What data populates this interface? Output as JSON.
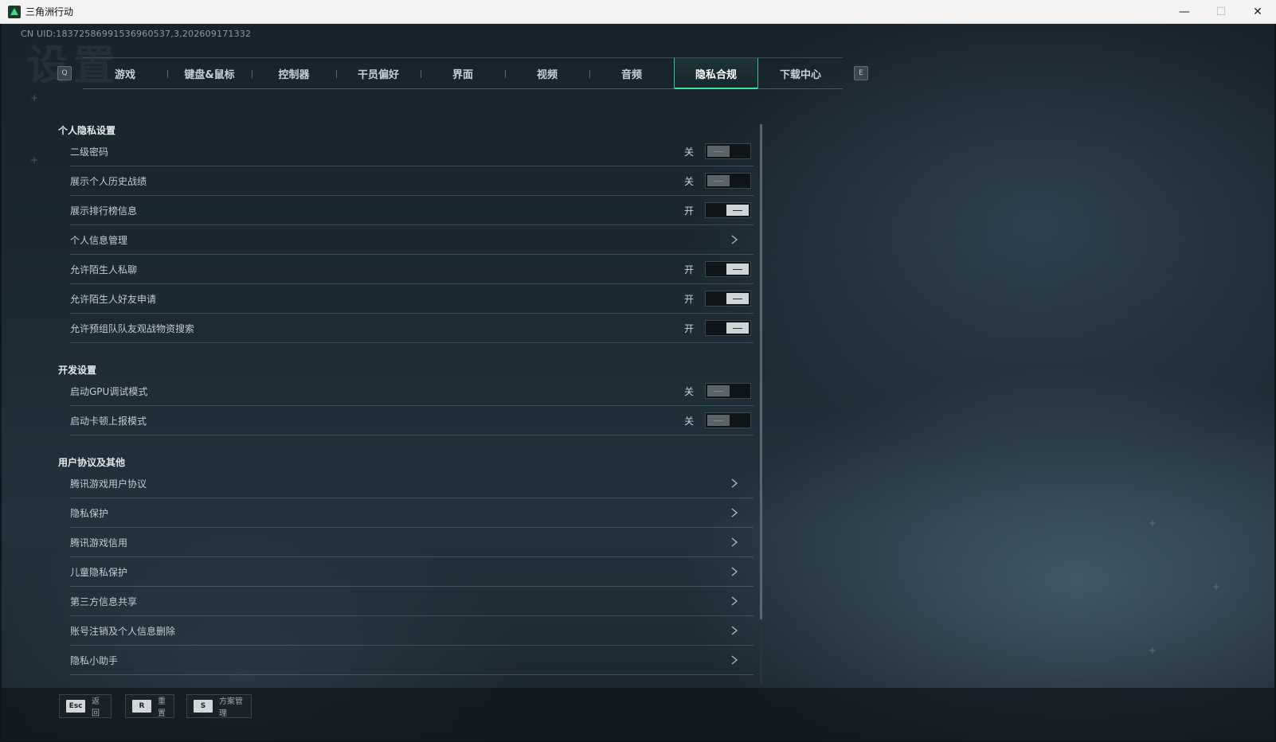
{
  "window": {
    "title": "三角洲行动",
    "minimize": "—",
    "maximize": "☐",
    "close": "✕"
  },
  "uid": "CN UID:18372586991536960537,3,202609171332",
  "watermark": "设置",
  "tabbar": {
    "prev_key": "Q",
    "next_key": "E",
    "tabs": [
      "游戏",
      "键盘&鼠标",
      "控制器",
      "干员偏好",
      "界面",
      "视频",
      "音频",
      "隐私合规",
      "下载中心"
    ],
    "active_index": 7
  },
  "sections": [
    {
      "title": "个人隐私设置",
      "rows": [
        {
          "label": "二级密码",
          "type": "toggle",
          "state": "关",
          "on": false
        },
        {
          "label": "展示个人历史战绩",
          "type": "toggle",
          "state": "关",
          "on": false
        },
        {
          "label": "展示排行榜信息",
          "type": "toggle",
          "state": "开",
          "on": true
        },
        {
          "label": "个人信息管理",
          "type": "link"
        },
        {
          "label": "允许陌生人私聊",
          "type": "toggle",
          "state": "开",
          "on": true
        },
        {
          "label": "允许陌生人好友申请",
          "type": "toggle",
          "state": "开",
          "on": true
        },
        {
          "label": "允许预组队队友观战物资搜索",
          "type": "toggle",
          "state": "开",
          "on": true
        }
      ]
    },
    {
      "title": "开发设置",
      "rows": [
        {
          "label": "启动GPU调试模式",
          "type": "toggle",
          "state": "关",
          "on": false
        },
        {
          "label": "启动卡顿上报模式",
          "type": "toggle",
          "state": "关",
          "on": false
        }
      ]
    },
    {
      "title": "用户协议及其他",
      "rows": [
        {
          "label": "腾讯游戏用户协议",
          "type": "link"
        },
        {
          "label": "隐私保护",
          "type": "link"
        },
        {
          "label": "腾讯游戏信用",
          "type": "link"
        },
        {
          "label": "儿童隐私保护",
          "type": "link"
        },
        {
          "label": "第三方信息共享",
          "type": "link"
        },
        {
          "label": "账号注销及个人信息删除",
          "type": "link"
        },
        {
          "label": "隐私小助手",
          "type": "link"
        }
      ]
    }
  ],
  "bottom": [
    {
      "key": "Esc",
      "label": "返回"
    },
    {
      "key": "R",
      "label": "重置"
    },
    {
      "key": "S",
      "label": "方案管理"
    }
  ],
  "colors": {
    "accent": "#3fe0a0",
    "background": "#1c2a33"
  }
}
